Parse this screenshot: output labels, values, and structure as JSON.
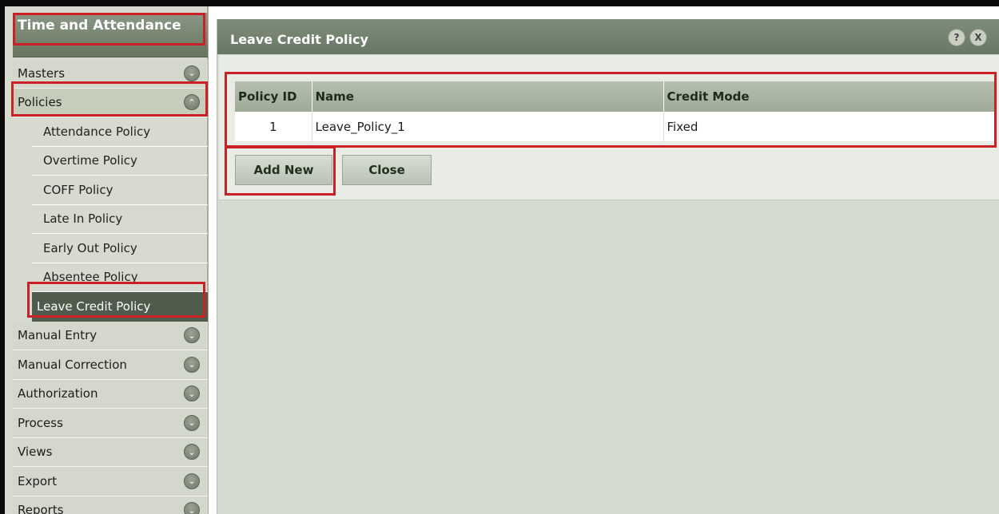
{
  "app": {
    "title": "Time and Attendance"
  },
  "sidebar": {
    "menu_before": [
      {
        "label": "Masters",
        "icon": "chevron-down-icon"
      },
      {
        "label": "Policies",
        "icon": "chevron-up-icon"
      }
    ],
    "policies_submenu": [
      {
        "label": "Attendance Policy"
      },
      {
        "label": "Overtime Policy"
      },
      {
        "label": "COFF Policy"
      },
      {
        "label": "Late In Policy"
      },
      {
        "label": "Early Out Policy"
      },
      {
        "label": "Absentee Policy"
      },
      {
        "label": "Leave Credit Policy",
        "active": true
      }
    ],
    "menu_after": [
      {
        "label": "Manual Entry",
        "icon": "chevron-down-icon"
      },
      {
        "label": "Manual Correction",
        "icon": "chevron-down-icon"
      },
      {
        "label": "Authorization",
        "icon": "chevron-down-icon"
      },
      {
        "label": "Process",
        "icon": "chevron-down-icon"
      },
      {
        "label": "Views",
        "icon": "chevron-down-icon"
      },
      {
        "label": "Export",
        "icon": "chevron-down-icon"
      },
      {
        "label": "Reports",
        "icon": "chevron-down-icon"
      }
    ]
  },
  "panel": {
    "title": "Leave Credit Policy",
    "help_glyph": "?",
    "close_glyph": "X",
    "table": {
      "headers": [
        "Policy ID",
        "Name",
        "Credit Mode"
      ],
      "rows": [
        [
          "1",
          "Leave_Policy_1",
          "Fixed"
        ]
      ]
    },
    "buttons": {
      "add_new": "Add New",
      "close": "Close"
    }
  },
  "colors": {
    "annotation": "#cc2027",
    "active_item": "#4f5c4c",
    "header": "#6f7f6a"
  }
}
